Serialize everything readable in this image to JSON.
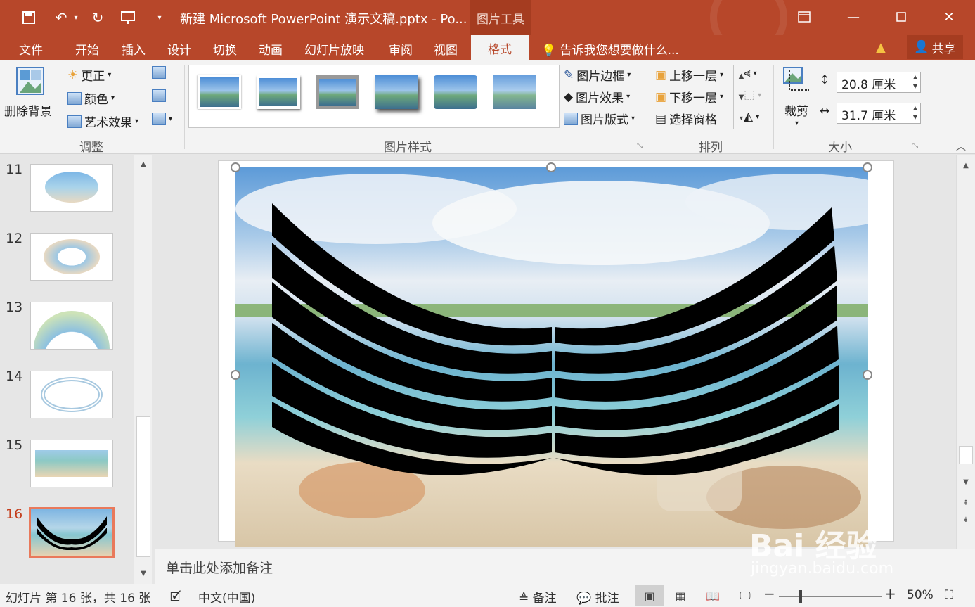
{
  "titlebar": {
    "title": "新建 Microsoft PowerPoint 演示文稿.pptx - Po...",
    "tools_tab": "图片工具",
    "icons": [
      "save-icon",
      "undo-icon",
      "redo-icon",
      "present-from-start-icon",
      "customize-icon"
    ]
  },
  "menu": {
    "tabs": [
      "文件",
      "开始",
      "插入",
      "设计",
      "切换",
      "动画",
      "幻灯片放映",
      "审阅",
      "视图",
      "格式"
    ],
    "active": "格式",
    "tellme": "告诉我您想要做什么...",
    "share": "共享"
  },
  "ribbon": {
    "adjust": {
      "remove_bg": "删除背景",
      "corrections": "更正",
      "color": "颜色",
      "artistic": "艺术效果",
      "label": "调整"
    },
    "styles": {
      "label": "图片样式",
      "border": "图片边框",
      "effects": "图片效果",
      "layout": "图片版式"
    },
    "arrange": {
      "label": "排列",
      "bring_forward": "上移一层",
      "send_backward": "下移一层",
      "selection_pane": "选择窗格"
    },
    "size": {
      "label": "大小",
      "crop": "裁剪",
      "height": "20.8 厘米",
      "width": "31.7 厘米"
    }
  },
  "slides": {
    "numbers": [
      "11",
      "12",
      "13",
      "14",
      "15",
      "16"
    ],
    "active": "16"
  },
  "notes": {
    "placeholder": "单击此处添加备注"
  },
  "status": {
    "slide_info": "幻灯片 第 16 张，共 16 张",
    "language": "中文(中国)",
    "notes_btn": "备注",
    "comments_btn": "批注",
    "zoom": "50%"
  },
  "watermark": {
    "brand": "Bai 经验",
    "url": "jingyan.baidu.com"
  },
  "colors": {
    "accent": "#b7472a",
    "accent_dark": "#a53c20"
  }
}
